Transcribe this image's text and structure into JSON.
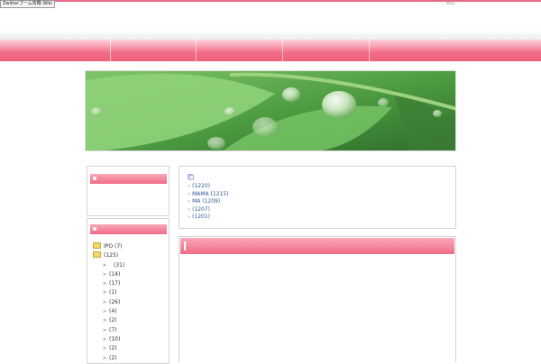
{
  "browser": {
    "tab_title": "Zwitterブーム攻略 Wiki"
  },
  "header": {
    "rss_separator": "|",
    "rss_label": "RSS"
  },
  "navbar": {
    "item_count": 5
  },
  "sidebar": {
    "categories": [
      {
        "label": "IPO (7)",
        "icon": "folder-icon"
      },
      {
        "label": "(125)",
        "icon": "folder-icon"
      },
      {
        "label": "(31)",
        "icon": "arrow-icon"
      },
      {
        "label": "(14)",
        "icon": "arrow-icon"
      },
      {
        "label": "(17)",
        "icon": "arrow-icon"
      },
      {
        "label": "(1)",
        "icon": "arrow-icon"
      },
      {
        "label": "(26)",
        "icon": "arrow-icon"
      },
      {
        "label": "(4)",
        "icon": "arrow-icon"
      },
      {
        "label": "(2)",
        "icon": "arrow-icon"
      },
      {
        "label": "(7)",
        "icon": "arrow-icon"
      },
      {
        "label": "(10)",
        "icon": "arrow-icon"
      },
      {
        "label": "(2)",
        "icon": "arrow-icon"
      },
      {
        "label": "(2)",
        "icon": "arrow-icon"
      }
    ]
  },
  "archives": {
    "months": [
      {
        "label": "(1220)"
      },
      {
        "label": "MAMA (1215)"
      },
      {
        "label": "MA (1209)"
      },
      {
        "label": "(1207)"
      },
      {
        "label": "(1201)"
      }
    ]
  },
  "colors": {
    "accent_pink": "#f06b85",
    "link_blue": "#335599"
  }
}
